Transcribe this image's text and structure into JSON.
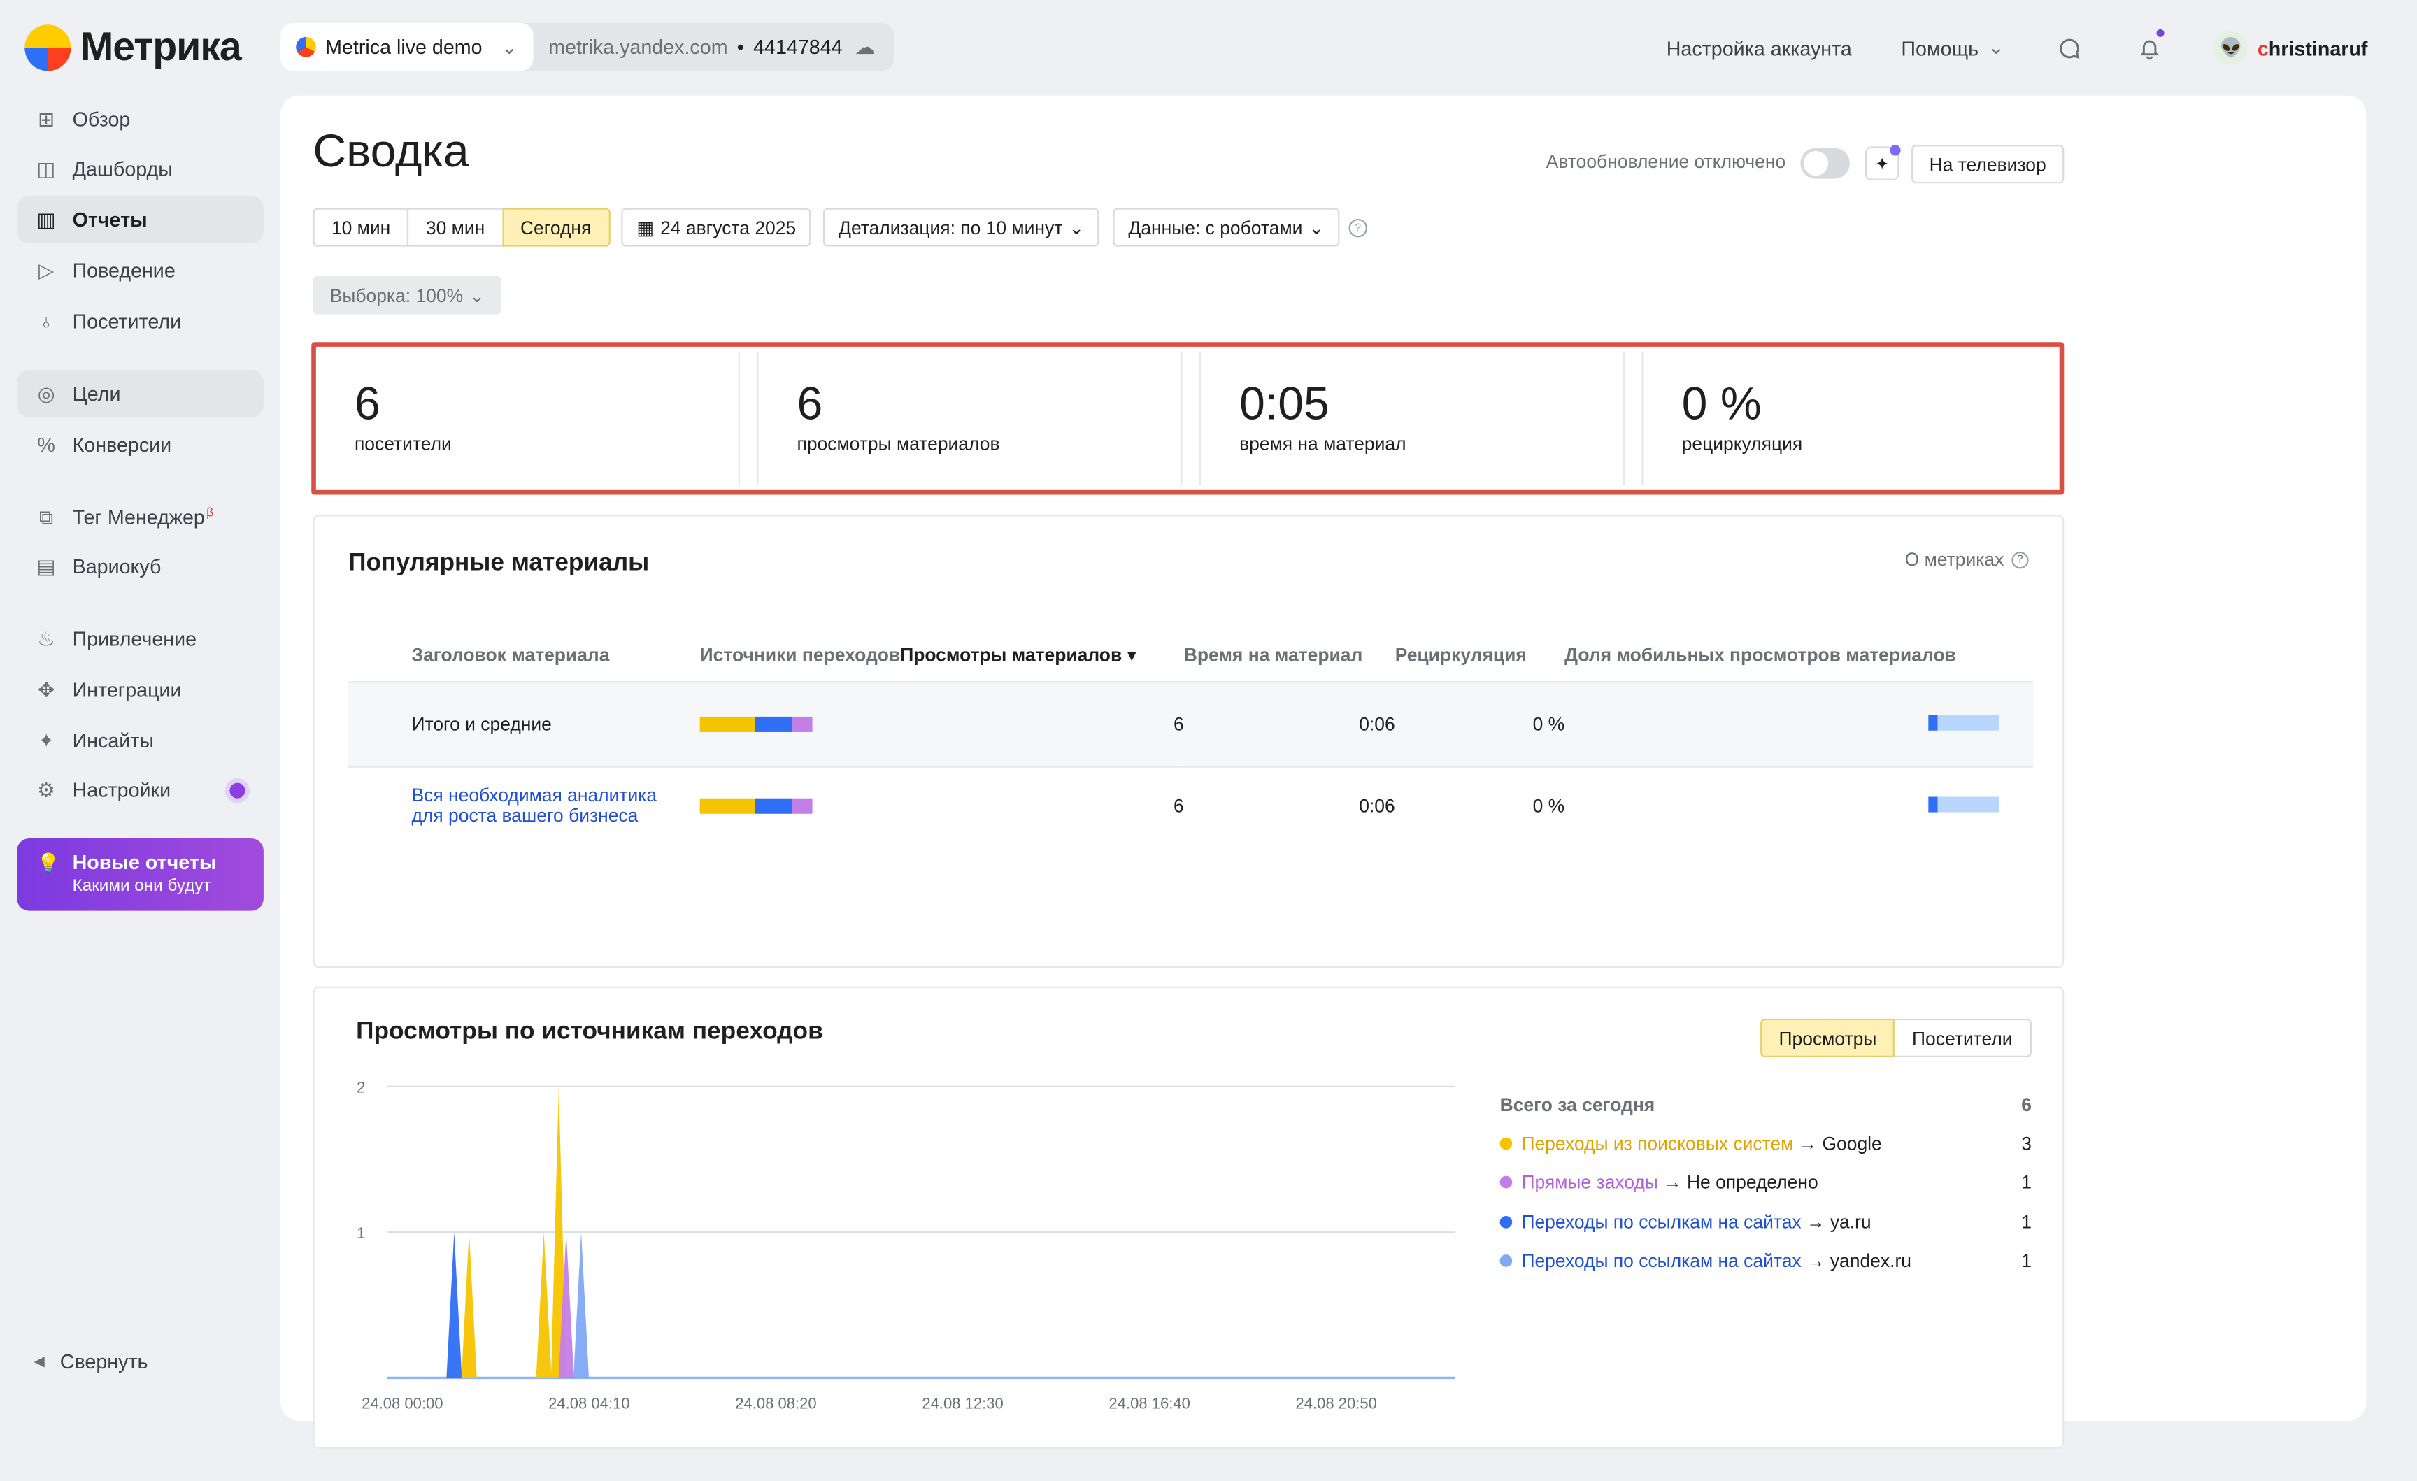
{
  "app": {
    "logo_text": "Метрика",
    "counter_name": "Metrica live demo",
    "counter_url": "metrika.yandex.com",
    "counter_sep": "•",
    "counter_id": "44147844"
  },
  "topnav": {
    "account_settings": "Настройка аккаунта",
    "help": "Помощь",
    "username_first": "c",
    "username_rest": "hristinaruf"
  },
  "sidebar": {
    "items": [
      {
        "label": "Обзор",
        "icon": "grid-icon"
      },
      {
        "label": "Дашборды",
        "icon": "dashboards-icon"
      },
      {
        "label": "Отчеты",
        "icon": "reports-icon"
      },
      {
        "label": "Поведение",
        "icon": "play-icon"
      },
      {
        "label": "Посетители",
        "icon": "person-icon"
      },
      {
        "label": "Цели",
        "icon": "target-icon"
      },
      {
        "label": "Конверсии",
        "icon": "percent-icon"
      },
      {
        "label": "Тег Менеджер",
        "icon": "tag-icon"
      },
      {
        "label": "Вариокуб",
        "icon": "cube-icon"
      },
      {
        "label": "Привлечение",
        "icon": "fire-icon"
      },
      {
        "label": "Интеграции",
        "icon": "puzzle-icon"
      },
      {
        "label": "Инсайты",
        "icon": "sparkle-icon"
      },
      {
        "label": "Настройки",
        "icon": "gear-icon"
      }
    ],
    "beta": "β",
    "promo_title": "Новые отчеты",
    "promo_sub": "Какими они будут",
    "collapse": "Свернуть"
  },
  "page": {
    "title": "Сводка",
    "autoupdate": "Автообновление отключено",
    "tv_button": "На телевизор",
    "periods": [
      "10 мин",
      "30 мин",
      "Сегодня"
    ],
    "date": "24 августа 2025",
    "detail": "Детализация: по 10 минут",
    "data_filter": "Данные: с роботами",
    "sample": "Выборка: 100%"
  },
  "kpis": [
    {
      "value": "6",
      "label": "посетители"
    },
    {
      "value": "6",
      "label": "просмотры материалов"
    },
    {
      "value": "0:05",
      "label": "время на материал"
    },
    {
      "value": "0 %",
      "label": "рециркуляция"
    }
  ],
  "popular": {
    "title": "Популярные материалы",
    "about": "О метриках",
    "columns": [
      "Заголовок материала",
      "Источники переходов",
      "Просмотры материалов ▾",
      "Время на материал",
      "Рециркуляция",
      "Доля мобильных просмотров материалов"
    ],
    "total": {
      "title": "Итого и средние",
      "views": "6",
      "time": "0:06",
      "recirc": "0 %"
    },
    "rows": [
      {
        "title_1": "Вся необходимая аналитика",
        "title_2": "для роста вашего бизнеса",
        "views": "6",
        "time": "0:06",
        "recirc": "0 %"
      }
    ]
  },
  "sources": {
    "title": "Просмотры по источникам переходов",
    "tabs": [
      "Просмотры",
      "Посетители"
    ],
    "legend_head": "Всего за сегодня",
    "legend_total": "6",
    "legend": [
      {
        "source": "Переходы из поисковых систем",
        "arrow": " → ",
        "target": "Google",
        "value": "3",
        "color": "#f5c400"
      },
      {
        "source": "Прямые заходы",
        "arrow": " → ",
        "target": "Не определено",
        "value": "1",
        "color": "#c47ee8"
      },
      {
        "source": "Переходы по ссылкам на сайтах",
        "arrow": " → ",
        "target": "ya.ru",
        "value": "1",
        "color": "#2f6ef6"
      },
      {
        "source": "Переходы по ссылкам на сайтах",
        "arrow": " → ",
        "target": "yandex.ru",
        "value": "1",
        "color": "#7fa9f5"
      }
    ]
  },
  "chart_data": {
    "type": "area",
    "ylim": [
      0,
      2
    ],
    "yticks": [
      "2",
      "1"
    ],
    "xticks": [
      "24.08 00:00",
      "24.08 04:10",
      "24.08 08:20",
      "24.08 12:30",
      "24.08 16:40",
      "24.08 20:50"
    ],
    "series": [
      {
        "name": "Переходы по ссылкам на сайтах → ya.ru",
        "color": "#2f6ef6",
        "points": [
          {
            "x": "24.08 01:30",
            "y": 1
          }
        ]
      },
      {
        "name": "Переходы из поисковых систем → Google",
        "color": "#f5c400",
        "points": [
          {
            "x": "24.08 01:50",
            "y": 1
          },
          {
            "x": "24.08 03:30",
            "y": 1
          },
          {
            "x": "24.08 03:50",
            "y": 2
          }
        ]
      },
      {
        "name": "Прямые заходы → Не определено",
        "color": "#c47ee8",
        "points": [
          {
            "x": "24.08 04:00",
            "y": 1
          }
        ]
      },
      {
        "name": "Переходы по ссылкам на сайтах → yandex.ru",
        "color": "#7fa9f5",
        "points": [
          {
            "x": "24.08 04:20",
            "y": 1
          }
        ]
      }
    ]
  }
}
